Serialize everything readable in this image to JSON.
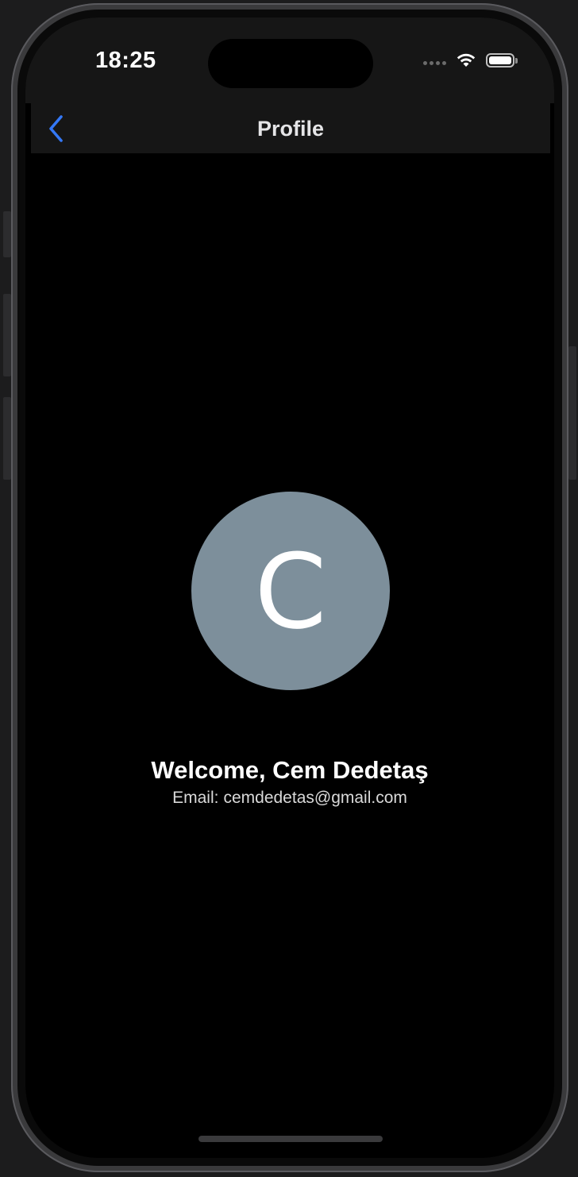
{
  "status_bar": {
    "time": "18:25",
    "icons": [
      "signal-dots-icon",
      "wifi-icon",
      "battery-icon"
    ]
  },
  "nav": {
    "title": "Profile",
    "back_icon": "chevron-left-icon",
    "accent_color": "#3478f6"
  },
  "profile": {
    "avatar_letter": "C",
    "avatar_color": "#7d8f9b",
    "welcome_text": "Welcome, Cem Dedetaş",
    "email_label": "Email:",
    "email_value": "cemdedetas@gmail.com"
  }
}
